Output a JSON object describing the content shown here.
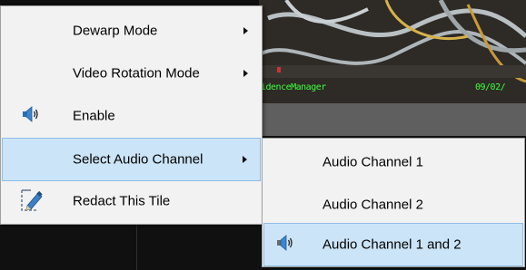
{
  "video": {
    "overlay_left": "idenceManager",
    "overlay_right": "09/02/"
  },
  "context_menu": {
    "items": [
      {
        "label": "Dewarp Mode",
        "has_submenu": true
      },
      {
        "label": "Video Rotation Mode",
        "has_submenu": true
      },
      {
        "label": "Enable",
        "icon": "speaker-icon"
      },
      {
        "label": "Select Audio Channel",
        "has_submenu": true,
        "highlighted": true
      },
      {
        "label": "Redact This Tile",
        "icon": "redact-pencil-icon"
      }
    ]
  },
  "submenu": {
    "items": [
      {
        "label": "Audio Channel 1"
      },
      {
        "label": "Audio Channel 2"
      },
      {
        "label": "Audio Channel 1 and 2",
        "icon": "speaker-icon",
        "highlighted": true
      }
    ]
  },
  "colors": {
    "menu_bg": "#f2f2f2",
    "highlight": "#cce4f7",
    "highlight_border": "#8fbde6",
    "overlay_text": "#3cff3c"
  }
}
